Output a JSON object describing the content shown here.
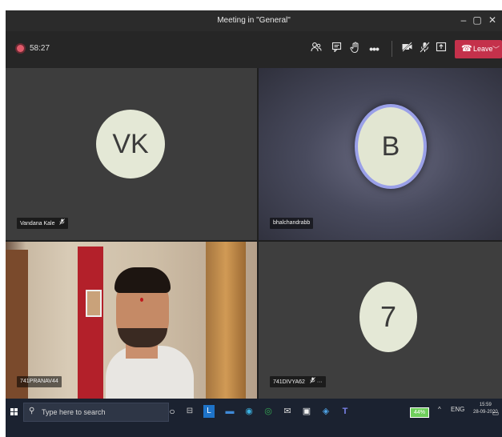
{
  "window": {
    "title": "Meeting in \"General\"",
    "minimize": "–",
    "maximize": "▢",
    "close": "✕"
  },
  "meeting": {
    "timer": "58:27",
    "toolbar_icons": [
      "participants-icon",
      "chat-icon",
      "raise-hand-icon",
      "more-options-icon",
      "camera-off-icon",
      "mic-off-icon",
      "share-screen-icon"
    ],
    "leave_label": "Leave",
    "leave_icon": "☎"
  },
  "participants": [
    {
      "name": "Vandana Kale",
      "initials": "VK",
      "muted": true
    },
    {
      "name": "bhalchandrabb",
      "initials": "B",
      "muted": false
    },
    {
      "name": "741PRANAV44",
      "initials": "",
      "muted": false,
      "video": true
    },
    {
      "name": "741DIVYA62",
      "initials": "7",
      "muted": true,
      "more": "···"
    }
  ],
  "taskbar": {
    "search_placeholder": "Type here to search",
    "battery": "44%",
    "language": "ENG",
    "time": "15:59",
    "date": "28-09-2020",
    "chevron": "^"
  },
  "colors": {
    "leave": "#c4314b",
    "accent_ring": "#9aa0e8",
    "avatar": "#e4e8d6"
  }
}
